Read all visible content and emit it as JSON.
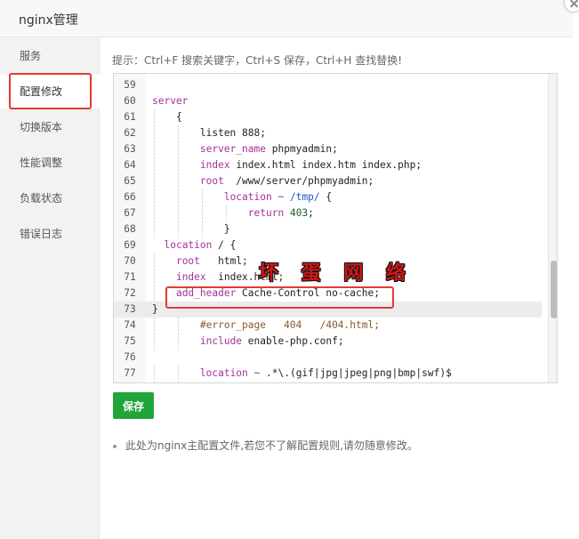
{
  "window": {
    "title": "nginx管理"
  },
  "sidebar": {
    "items": [
      {
        "label": "服务"
      },
      {
        "label": "配置修改"
      },
      {
        "label": "切换版本"
      },
      {
        "label": "性能调整"
      },
      {
        "label": "负载状态"
      },
      {
        "label": "错误日志"
      }
    ],
    "active_index": 1
  },
  "content": {
    "tip": "提示：Ctrl+F 搜索关键字，Ctrl+S 保存，Ctrl+H 查找替换!",
    "save_label": "保存",
    "note": "此处为nginx主配置文件,若您不了解配置规则,请勿随意修改。"
  },
  "editor": {
    "current_line": "73",
    "lines": [
      {
        "num": "59",
        "code": ""
      },
      {
        "num": "60",
        "code": "server"
      },
      {
        "num": "61",
        "code": "    {"
      },
      {
        "num": "62",
        "code": "        listen 888;"
      },
      {
        "num": "63",
        "code": "        server_name phpmyadmin;"
      },
      {
        "num": "64",
        "code": "        index index.html index.htm index.php;"
      },
      {
        "num": "65",
        "code": "        root  /www/server/phpmyadmin;"
      },
      {
        "num": "66",
        "code": "            location ~ /tmp/ {"
      },
      {
        "num": "67",
        "code": "                return 403;"
      },
      {
        "num": "68",
        "code": "            }"
      },
      {
        "num": "69",
        "code": "  location / {"
      },
      {
        "num": "70",
        "code": "    root   html;"
      },
      {
        "num": "71",
        "code": "    index  index.html;"
      },
      {
        "num": "72",
        "code": "    add_header Cache-Control no-cache;"
      },
      {
        "num": "73",
        "code": "}"
      },
      {
        "num": "74",
        "code": "        #error_page   404   /404.html;"
      },
      {
        "num": "75",
        "code": "        include enable-php.conf;"
      },
      {
        "num": "76",
        "code": ""
      },
      {
        "num": "77",
        "code": "        location ~ .*\\.(gif|jpg|jpeg|png|bmp|swf)$"
      }
    ]
  },
  "watermark": "坏 蛋 网 络",
  "colors": {
    "accent_green": "#20a53a",
    "highlight_red": "#e53935"
  }
}
